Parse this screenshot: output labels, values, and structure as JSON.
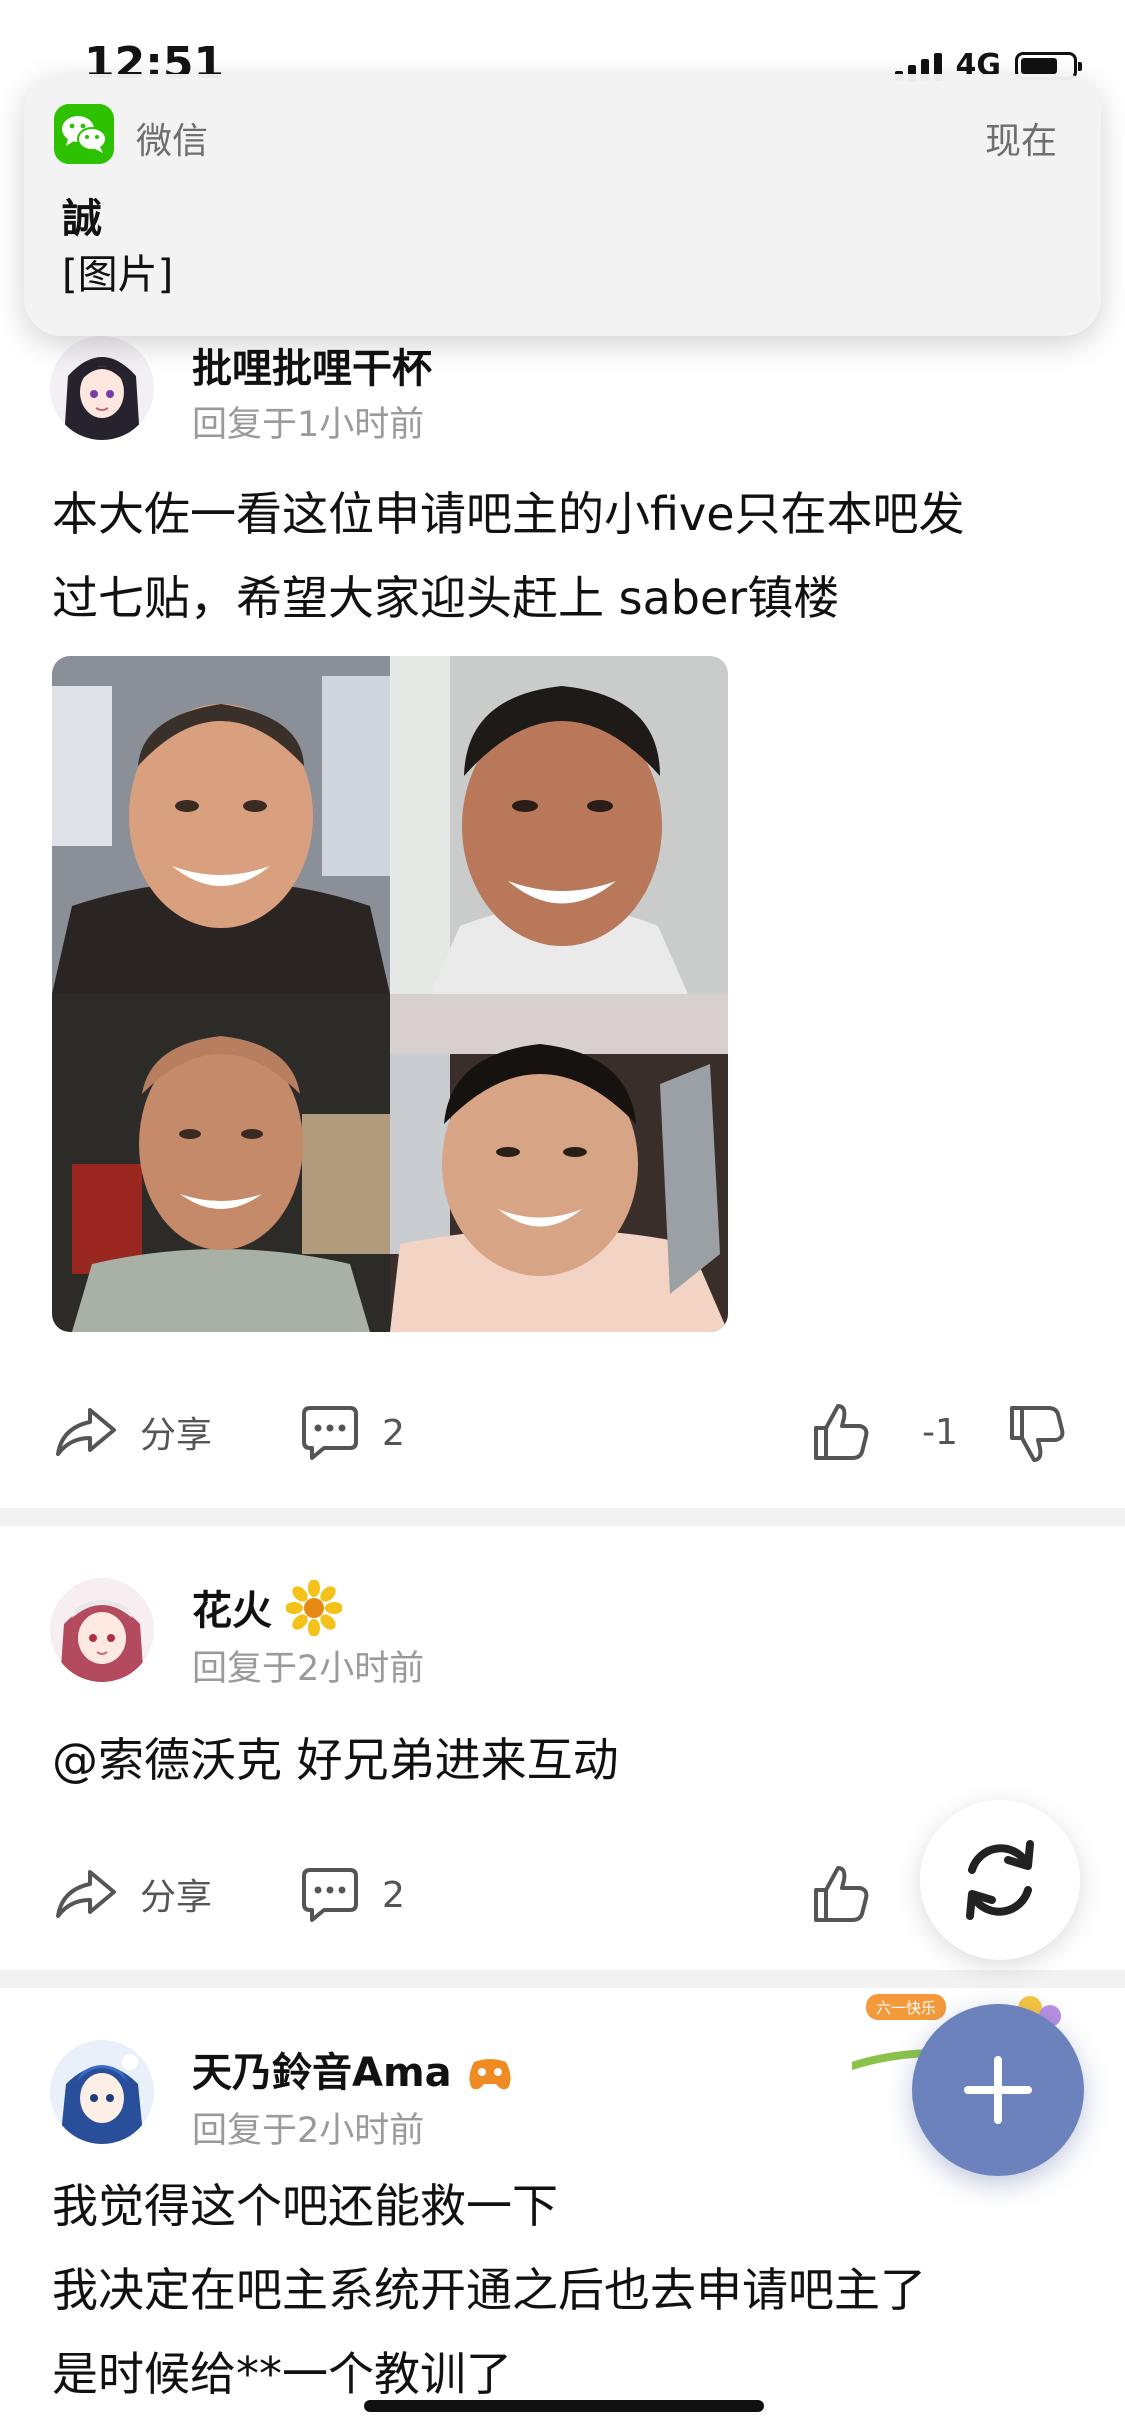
{
  "status_bar": {
    "time": "12:51",
    "network": "4G"
  },
  "notification": {
    "app_name": "微信",
    "time": "现在",
    "title": "誠",
    "body": "[图片]"
  },
  "posts": [
    {
      "username": "批哩批哩干杯",
      "meta": "回复于1小时前",
      "content_lines": [
        "本大佐一看这位申请吧主的小five只在本吧发",
        "过七贴，希望大家迎头赶上 saber镇楼"
      ],
      "share_label": "分享",
      "comment_count": "2",
      "vote_count": "-1",
      "image_count": 4
    },
    {
      "username": "花火",
      "meta": "回复于2小时前",
      "content_lines": [
        "@索德沃克 好兄弟进来互动"
      ],
      "share_label": "分享",
      "comment_count": "2"
    },
    {
      "username": "天乃鈴音Ama",
      "meta": "回复于2小时前",
      "content_lines": [
        "我觉得这个吧还能救一下",
        "我决定在吧主系统开通之后也去申请吧主了",
        "是时候给**一个教训了"
      ]
    }
  ],
  "fab": {
    "refresh_icon": "refresh-icon",
    "add_icon": "plus-icon",
    "badge_text": "六一快乐"
  },
  "colors": {
    "wechat_green": "#2dc100",
    "fab_blue": "#6b82bd",
    "meta_gray": "#9a9a9a"
  }
}
